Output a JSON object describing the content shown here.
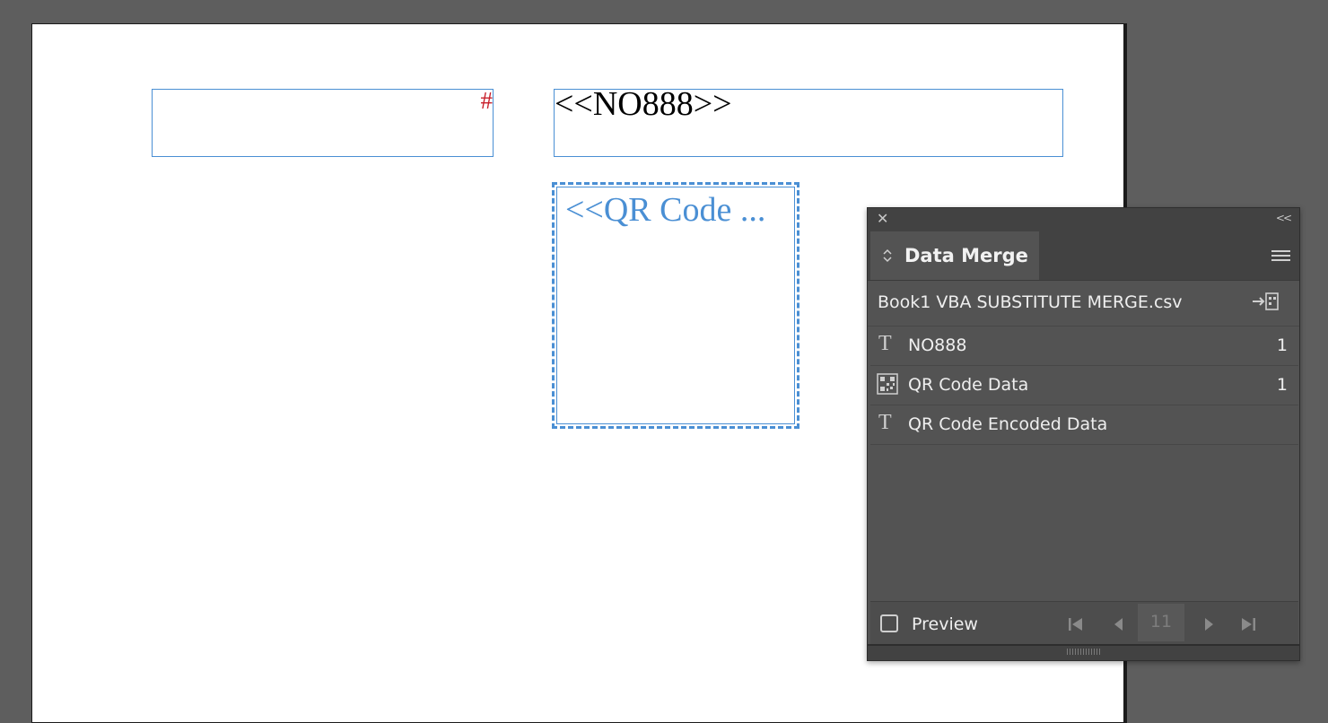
{
  "document": {
    "hash_frame_marker": "#",
    "no_field_placeholder": "<<NO888>>",
    "qr_field_placeholder": "<<QR Code ..."
  },
  "panel": {
    "tab_label": "Data Merge",
    "source_file": "Book1 VBA SUBSTITUTE MERGE.csv",
    "fields": [
      {
        "label": "NO888",
        "icon": "text-field-icon",
        "count": "1"
      },
      {
        "label": "QR Code Data",
        "icon": "image-field-icon",
        "count": "1"
      },
      {
        "label": "QR Code Encoded Data",
        "icon": "text-field-icon",
        "count": ""
      }
    ],
    "preview_label": "Preview",
    "preview_checked": false,
    "record_number": "11"
  },
  "colors": {
    "frame_blue": "#4a8fd4",
    "overset_red": "#c8202b",
    "panel_bg": "#535353"
  }
}
